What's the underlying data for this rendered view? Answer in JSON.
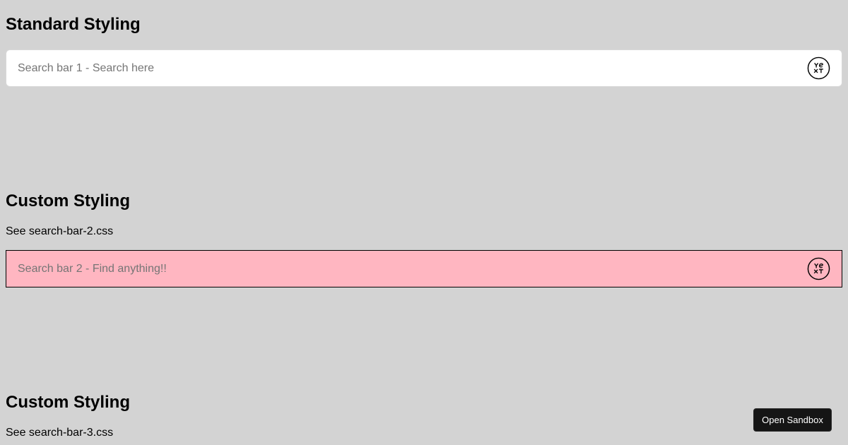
{
  "sections": [
    {
      "heading": "Standard Styling",
      "note": "",
      "search_placeholder": "Search bar 1 - Search here",
      "style": "standard",
      "background": "#ffffff"
    },
    {
      "heading": "Custom Styling",
      "note": "See search-bar-2.css",
      "search_placeholder": "Search bar 2 - Find anything!!",
      "style": "custom",
      "background": "#ffb6c1"
    },
    {
      "heading": "Custom Styling",
      "note": "See search-bar-3.css"
    }
  ],
  "logo": {
    "icon": "yext-logo-icon",
    "text": "YEXT"
  },
  "sandbox_button_label": "Open Sandbox",
  "colors": {
    "page_background": "#d3d3d3",
    "custom_search_background": "#ffb6c1",
    "sandbox_button_background": "#151515"
  }
}
